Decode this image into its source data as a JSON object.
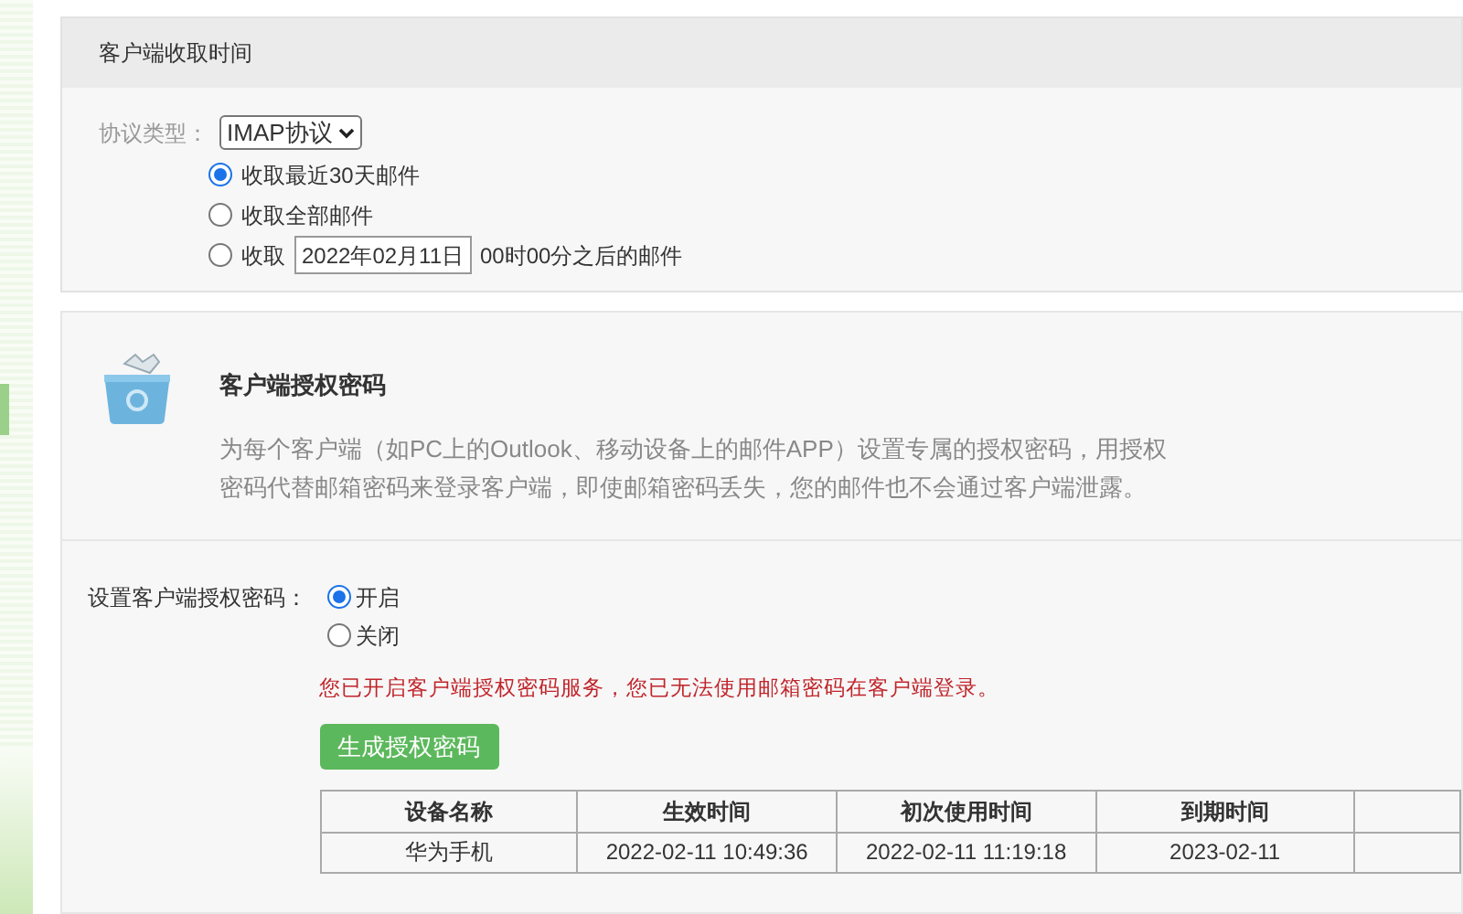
{
  "fetch_section": {
    "title": "客户端收取时间",
    "protocol_label": "协议类型：",
    "protocol_value": "IMAP协议",
    "options": [
      {
        "kind": "plain",
        "label": "收取最近30天邮件",
        "selected": true
      },
      {
        "kind": "plain",
        "label": "收取全部邮件",
        "selected": false
      },
      {
        "kind": "date",
        "label": "收取",
        "date": "2022年02月11日",
        "suffix": "00时00分之后的邮件",
        "selected": false
      }
    ]
  },
  "auth_intro": {
    "title": "客户端授权密码",
    "description": "为每个客户端（如PC上的Outlook、移动设备上的邮件APP）设置专属的授权密码，用授权密码代替邮箱密码来登录客户端，即使邮箱密码丢失，您的邮件也不会通过客户端泄露。"
  },
  "auth_settings": {
    "label": "设置客户端授权密码：",
    "options": [
      {
        "label": "开启",
        "selected": true
      },
      {
        "label": "关闭",
        "selected": false
      }
    ],
    "warning": "您已开启客户端授权密码服务，您已无法使用邮箱密码在客户端登录。",
    "generate_button": "生成授权密码",
    "table": {
      "columns": [
        "设备名称",
        "生效时间",
        "初次使用时间",
        "到期时间"
      ],
      "rows": [
        [
          "华为手机",
          "2022-02-11 10:49:36",
          "2022-02-11 11:19:18",
          "2023-02-11"
        ]
      ]
    }
  }
}
